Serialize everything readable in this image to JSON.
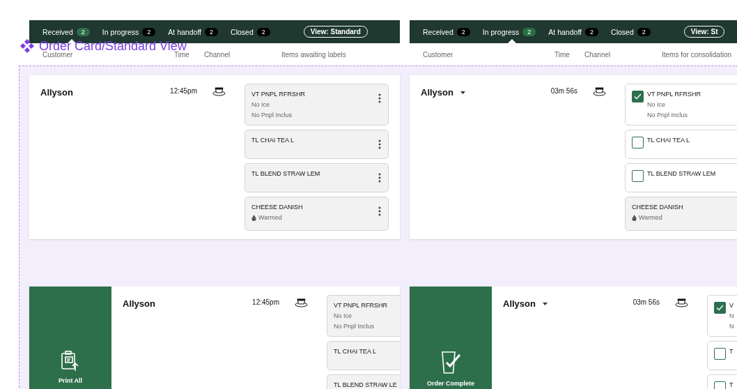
{
  "component_label": "Order Card/Standard View",
  "frames": [
    {
      "tabs": [
        {
          "label": "Received",
          "count": "2",
          "selected": true
        },
        {
          "label": "In progress",
          "count": "2",
          "selected": false
        },
        {
          "label": "At handoff",
          "count": "2",
          "selected": false
        },
        {
          "label": "Closed",
          "count": "2",
          "selected": false
        }
      ],
      "view_button": "View: Standard",
      "columns": [
        "Customer",
        "Time",
        "Channel",
        "Items awaiting labels"
      ]
    },
    {
      "tabs": [
        {
          "label": "Received",
          "count": "2",
          "selected": false
        },
        {
          "label": "In progress",
          "count": "2",
          "selected": true
        },
        {
          "label": "At handoff",
          "count": "2",
          "selected": false
        },
        {
          "label": "Closed",
          "count": "2",
          "selected": false
        }
      ],
      "view_button": "View: St",
      "columns": [
        "Customer",
        "Time",
        "Channel",
        "Items for consolidation"
      ]
    }
  ],
  "cards": [
    {
      "customer": "Allyson",
      "has_menu": false,
      "time": "12:45pm",
      "items": [
        {
          "kind": "menu",
          "name": "VT PNPL RFRSHR",
          "notes": [
            {
              "kind": "plain",
              "text": "No Ice"
            },
            {
              "kind": "plain",
              "text": "No Pnpl Inclus"
            }
          ]
        },
        {
          "kind": "menu",
          "name": "TL CHAI TEA L"
        },
        {
          "kind": "menu",
          "name": "TL BLEND STRAW LEM"
        },
        {
          "kind": "menu",
          "name": "CHEESE DANISH",
          "notes": [
            {
              "kind": "warmed",
              "text": "Warmed"
            }
          ]
        }
      ]
    },
    {
      "customer": "Allyson",
      "has_menu": true,
      "time": "03m 56s",
      "items": [
        {
          "kind": "checkbox",
          "checked": true,
          "name": "VT PNPL RFRSHR",
          "notes": [
            {
              "kind": "plain",
              "text": "No Ice"
            },
            {
              "kind": "plain",
              "text": "No Pnpl Inclus"
            }
          ]
        },
        {
          "kind": "checkbox",
          "checked": false,
          "name": "TL CHAI TEA L"
        },
        {
          "kind": "checkbox",
          "checked": false,
          "name": "TL BLEND STRAW LEM"
        },
        {
          "kind": "food",
          "name": "CHEESE DANISH",
          "notes": [
            {
              "kind": "warmed",
              "text": "Warmed"
            }
          ]
        }
      ]
    },
    {
      "customer": "Allyson",
      "has_menu": false,
      "time": "12:45pm",
      "action": {
        "kind": "print",
        "label": "Print All"
      },
      "items": [
        {
          "kind": "menu",
          "name": "VT PNPL RFRSHR",
          "notes": [
            {
              "kind": "plain",
              "text": "No Ice"
            },
            {
              "kind": "plain",
              "text": "No Pnpl Inclus"
            }
          ]
        },
        {
          "kind": "menu",
          "name": "TL CHAI TEA L"
        },
        {
          "kind": "menu",
          "name": "TL BLEND STRAW LE"
        }
      ]
    },
    {
      "customer": "Allyson",
      "has_menu": true,
      "time": "03m 56s",
      "action": {
        "kind": "complete",
        "label": "Order Complete"
      },
      "items": [
        {
          "kind": "checkbox",
          "checked": true,
          "name": "V",
          "notes": [
            {
              "kind": "plain",
              "text": "N"
            },
            {
              "kind": "plain",
              "text": "N"
            }
          ]
        },
        {
          "kind": "checkbox",
          "checked": false,
          "name": "T"
        },
        {
          "kind": "checkbox",
          "checked": false,
          "name": "T"
        }
      ]
    }
  ]
}
